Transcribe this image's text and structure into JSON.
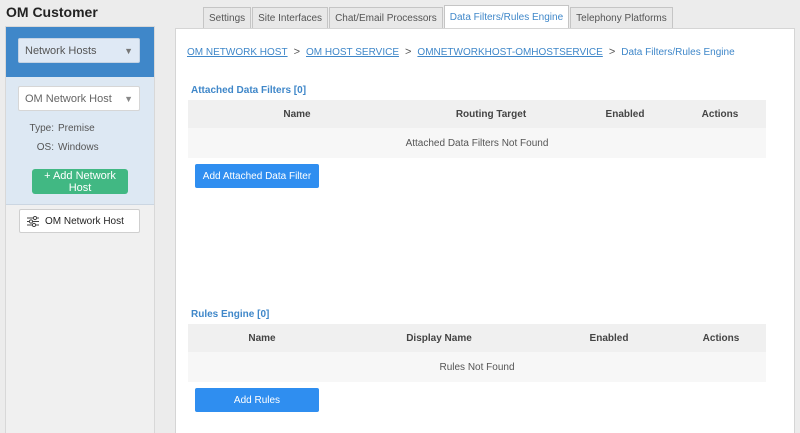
{
  "app": {
    "title": "OM Customer"
  },
  "sidebar": {
    "top_select": "Network Hosts",
    "host_select": "OM Network Host",
    "type_label": "Type:",
    "type_value": "Premise",
    "os_label": "OS:",
    "os_value": "Windows",
    "add_button": "+ Add Network Host",
    "host_card_label": "OM Network Host"
  },
  "tabs": [
    {
      "label": "Settings",
      "active": false
    },
    {
      "label": "Site Interfaces",
      "active": false
    },
    {
      "label": "Chat/Email Processors",
      "active": false
    },
    {
      "label": "Data Filters/Rules Engine",
      "active": true
    },
    {
      "label": "Telephony Platforms",
      "active": false
    }
  ],
  "breadcrumb": {
    "items": [
      "OM NETWORK HOST",
      "OM HOST SERVICE",
      "OMNETWORKHOST-OMHOSTSERVICE"
    ],
    "current": "Data Filters/Rules Engine",
    "separator": ">"
  },
  "data_filters": {
    "title": "Attached Data Filters [0]",
    "columns": [
      "Name",
      "Routing Target",
      "Enabled",
      "Actions"
    ],
    "empty_text": "Attached Data Filters Not Found",
    "add_button": "Add Attached Data Filter"
  },
  "rules_engine": {
    "title": "Rules Engine [0]",
    "columns": [
      "Name",
      "Display Name",
      "Enabled",
      "Actions"
    ],
    "empty_text": "Rules Not Found",
    "add_button": "Add Rules"
  },
  "colors": {
    "accent": "#3f87c9",
    "primary_button": "#2f8ef0",
    "success_button": "#41b883"
  },
  "icons": {
    "select_chevron": "chevron-down-icon",
    "host_card": "sliders-icon"
  }
}
